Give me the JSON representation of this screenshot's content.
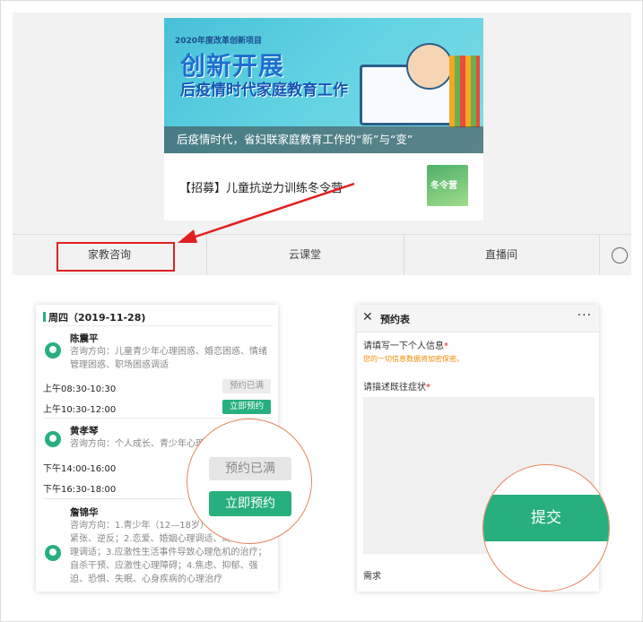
{
  "banner": {
    "tag": "2020年度改革创新项目",
    "title_line1": "创新开展",
    "title_line2": "后疫情时代家庭教育工作",
    "caption": "后疫情时代，省妇联家庭教育工作的“新”与“变”"
  },
  "article": {
    "title": "【招募】儿童抗逆力训练冬令营",
    "thumb_text": "冬令营"
  },
  "tabs": [
    {
      "label": "家教咨询"
    },
    {
      "label": "云课堂"
    },
    {
      "label": "直播间"
    }
  ],
  "schedule": {
    "date": "周四（2019-11-28)",
    "experts": [
      {
        "name": "陈震平",
        "desc": "咨询方向：儿童青少年心理困惑、婚恋困惑、情绪管理困惑、职场困惑调适",
        "slots": [
          {
            "time": "上午08:30-10:30",
            "status": "预约已满"
          },
          {
            "time": "上午10:30-12:00",
            "status": "立即预约"
          }
        ]
      },
      {
        "name": "黄孝琴",
        "desc": "咨询方向：个人成长、青少年心理",
        "slots": [
          {
            "time": "下午14:00-16:00"
          },
          {
            "time": "下午16:30-18:00"
          }
        ]
      },
      {
        "name": "詹锦华",
        "desc": "咨询方向：1.青少年（12—18岁）网瘾、亲子关系紧张、逆反；2.恋爱、婚姻心理调适、离婚再婚心理调适；3.应激性生活事件导致心理危机的治疗；自杀干预、应激性心理障碍；4.焦虑、抑郁、强迫、恐惧、失眠、心身疾病的心理治疗"
      }
    ]
  },
  "zoom_left": {
    "full_label": "预约已满",
    "book_label": "立即预约"
  },
  "form": {
    "title": "预约表",
    "field1_label": "请填写一下个人信息",
    "field1_note": "您的一切信息数据将加密保密。",
    "field2_label": "请描述既往症状",
    "field3_label": "需求",
    "submit_label": "提交"
  },
  "colors": {
    "accent": "#27b07d",
    "highlight": "#e02020"
  }
}
